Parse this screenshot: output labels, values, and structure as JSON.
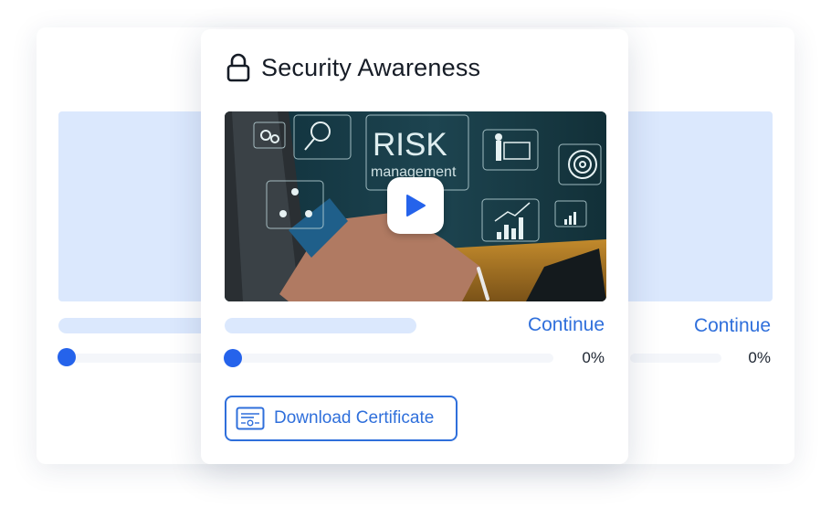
{
  "background_course_left": {
    "progress_percent": 0
  },
  "background_course_right": {
    "continue_label": "Continue",
    "progress_percent_label": "0%",
    "progress_percent": 0
  },
  "course": {
    "title": "Security Awareness",
    "title_icon": "lock-icon",
    "video": {
      "overlay_word": "RISK",
      "overlay_subword": "management",
      "play_icon": "play-icon"
    },
    "continue_label": "Continue",
    "progress_percent_label": "0%",
    "progress_percent": 0,
    "download_button": {
      "label": "Download Certificate",
      "icon": "certificate-icon"
    }
  },
  "colors": {
    "accent": "#2563eb",
    "link_text": "#2f6fdb",
    "placeholder": "#dbe8fd",
    "track": "#f4f6fa"
  }
}
